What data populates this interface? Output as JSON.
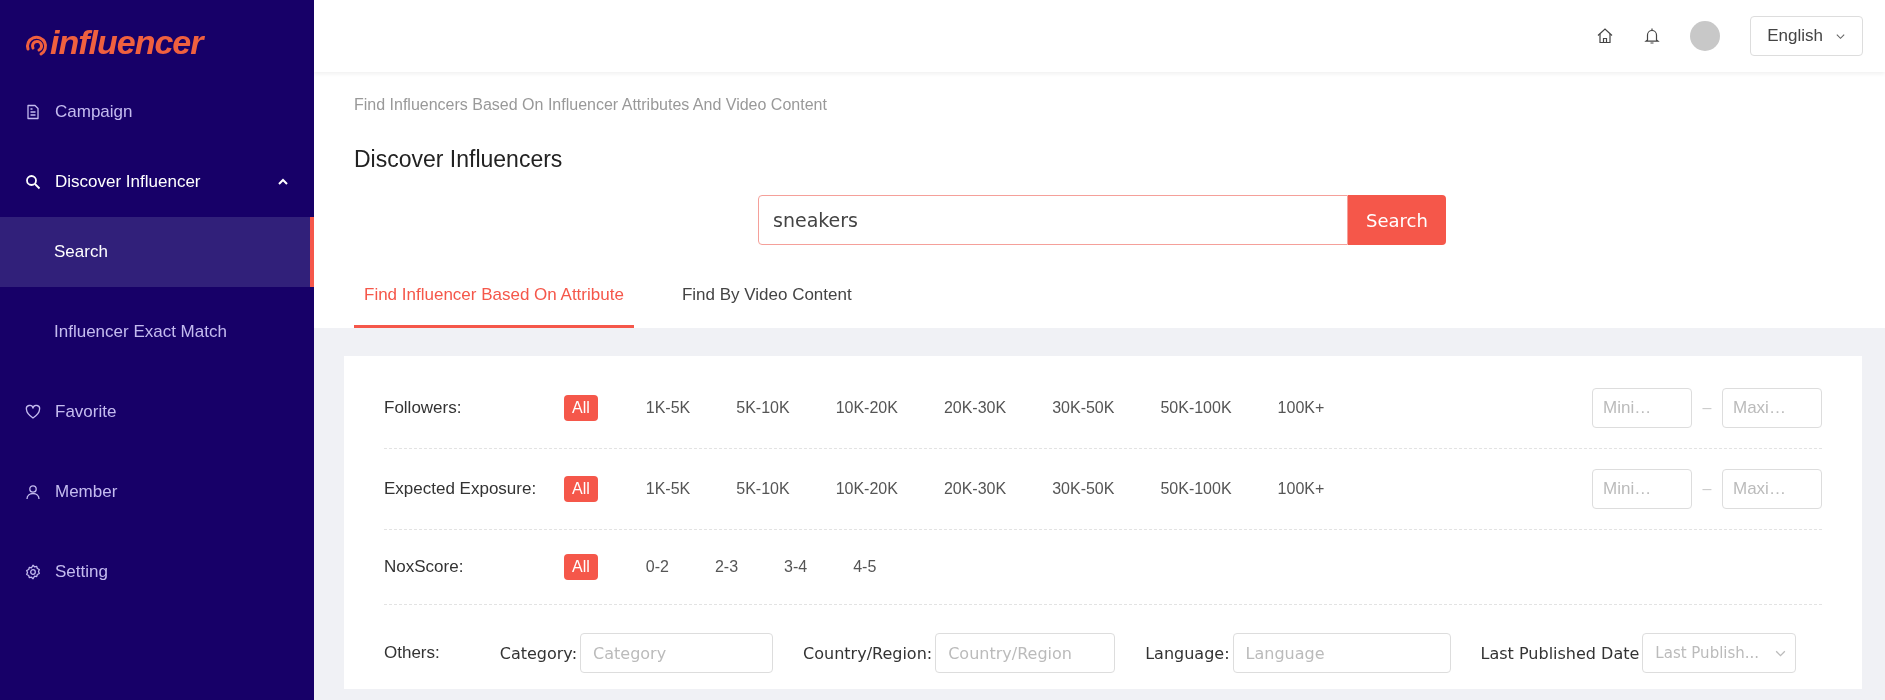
{
  "logo": {
    "text": "influencer"
  },
  "sidebar": {
    "items": [
      {
        "label": "Campaign",
        "selected": false
      },
      {
        "label": "Discover Influencer",
        "selected": false,
        "expanded": true,
        "children": [
          {
            "label": "Search",
            "selected": true
          },
          {
            "label": "Influencer Exact Match",
            "selected": false
          }
        ]
      },
      {
        "label": "Favorite",
        "selected": false
      },
      {
        "label": "Member",
        "selected": false
      },
      {
        "label": "Setting",
        "selected": false
      }
    ]
  },
  "header": {
    "language": "English"
  },
  "page": {
    "breadcrumb": "Find Influencers Based On Influencer Attributes And Video Content",
    "title": "Discover Influencers"
  },
  "search": {
    "value": "sneakers",
    "button": "Search"
  },
  "tabs": [
    {
      "label": "Find Influencer Based On Attribute",
      "selected": true
    },
    {
      "label": "Find By Video Content",
      "selected": false
    }
  ],
  "filters": [
    {
      "kind": "range",
      "label": "Followers:",
      "options": [
        {
          "label": "All",
          "selected": true
        },
        {
          "label": "1K-5K",
          "selected": false
        },
        {
          "label": "5K-10K",
          "selected": false
        },
        {
          "label": "10K-20K",
          "selected": false
        },
        {
          "label": "20K-30K",
          "selected": false
        },
        {
          "label": "30K-50K",
          "selected": false
        },
        {
          "label": "50K-100K",
          "selected": false
        },
        {
          "label": "100K+",
          "selected": false
        }
      ],
      "min_placeholder": "Mini…",
      "separator": "–",
      "max_placeholder": "Maxi…"
    },
    {
      "kind": "range",
      "label": "Expected Exposure:",
      "options": [
        {
          "label": "All",
          "selected": true
        },
        {
          "label": "1K-5K",
          "selected": false
        },
        {
          "label": "5K-10K",
          "selected": false
        },
        {
          "label": "10K-20K",
          "selected": false
        },
        {
          "label": "20K-30K",
          "selected": false
        },
        {
          "label": "30K-50K",
          "selected": false
        },
        {
          "label": "50K-100K",
          "selected": false
        },
        {
          "label": "100K+",
          "selected": false
        }
      ],
      "min_placeholder": "Mini…",
      "separator": "–",
      "max_placeholder": "Maxi…"
    },
    {
      "kind": "options",
      "label": "NoxScore:",
      "options": [
        {
          "label": "All",
          "selected": true
        },
        {
          "label": "0-2",
          "selected": false
        },
        {
          "label": "2-3",
          "selected": false
        },
        {
          "label": "3-4",
          "selected": false
        },
        {
          "label": "4-5",
          "selected": false
        }
      ]
    }
  ],
  "others": {
    "label": "Others:",
    "fields": [
      {
        "kind": "input",
        "label": "Category:",
        "placeholder": "Category"
      },
      {
        "kind": "input",
        "label": "Country/Region:",
        "placeholder": "Country/Region"
      },
      {
        "kind": "input",
        "label": "Language:",
        "placeholder": "Language"
      },
      {
        "kind": "select",
        "label": "Last Published Date",
        "placeholder": "Last Publish..."
      }
    ]
  }
}
